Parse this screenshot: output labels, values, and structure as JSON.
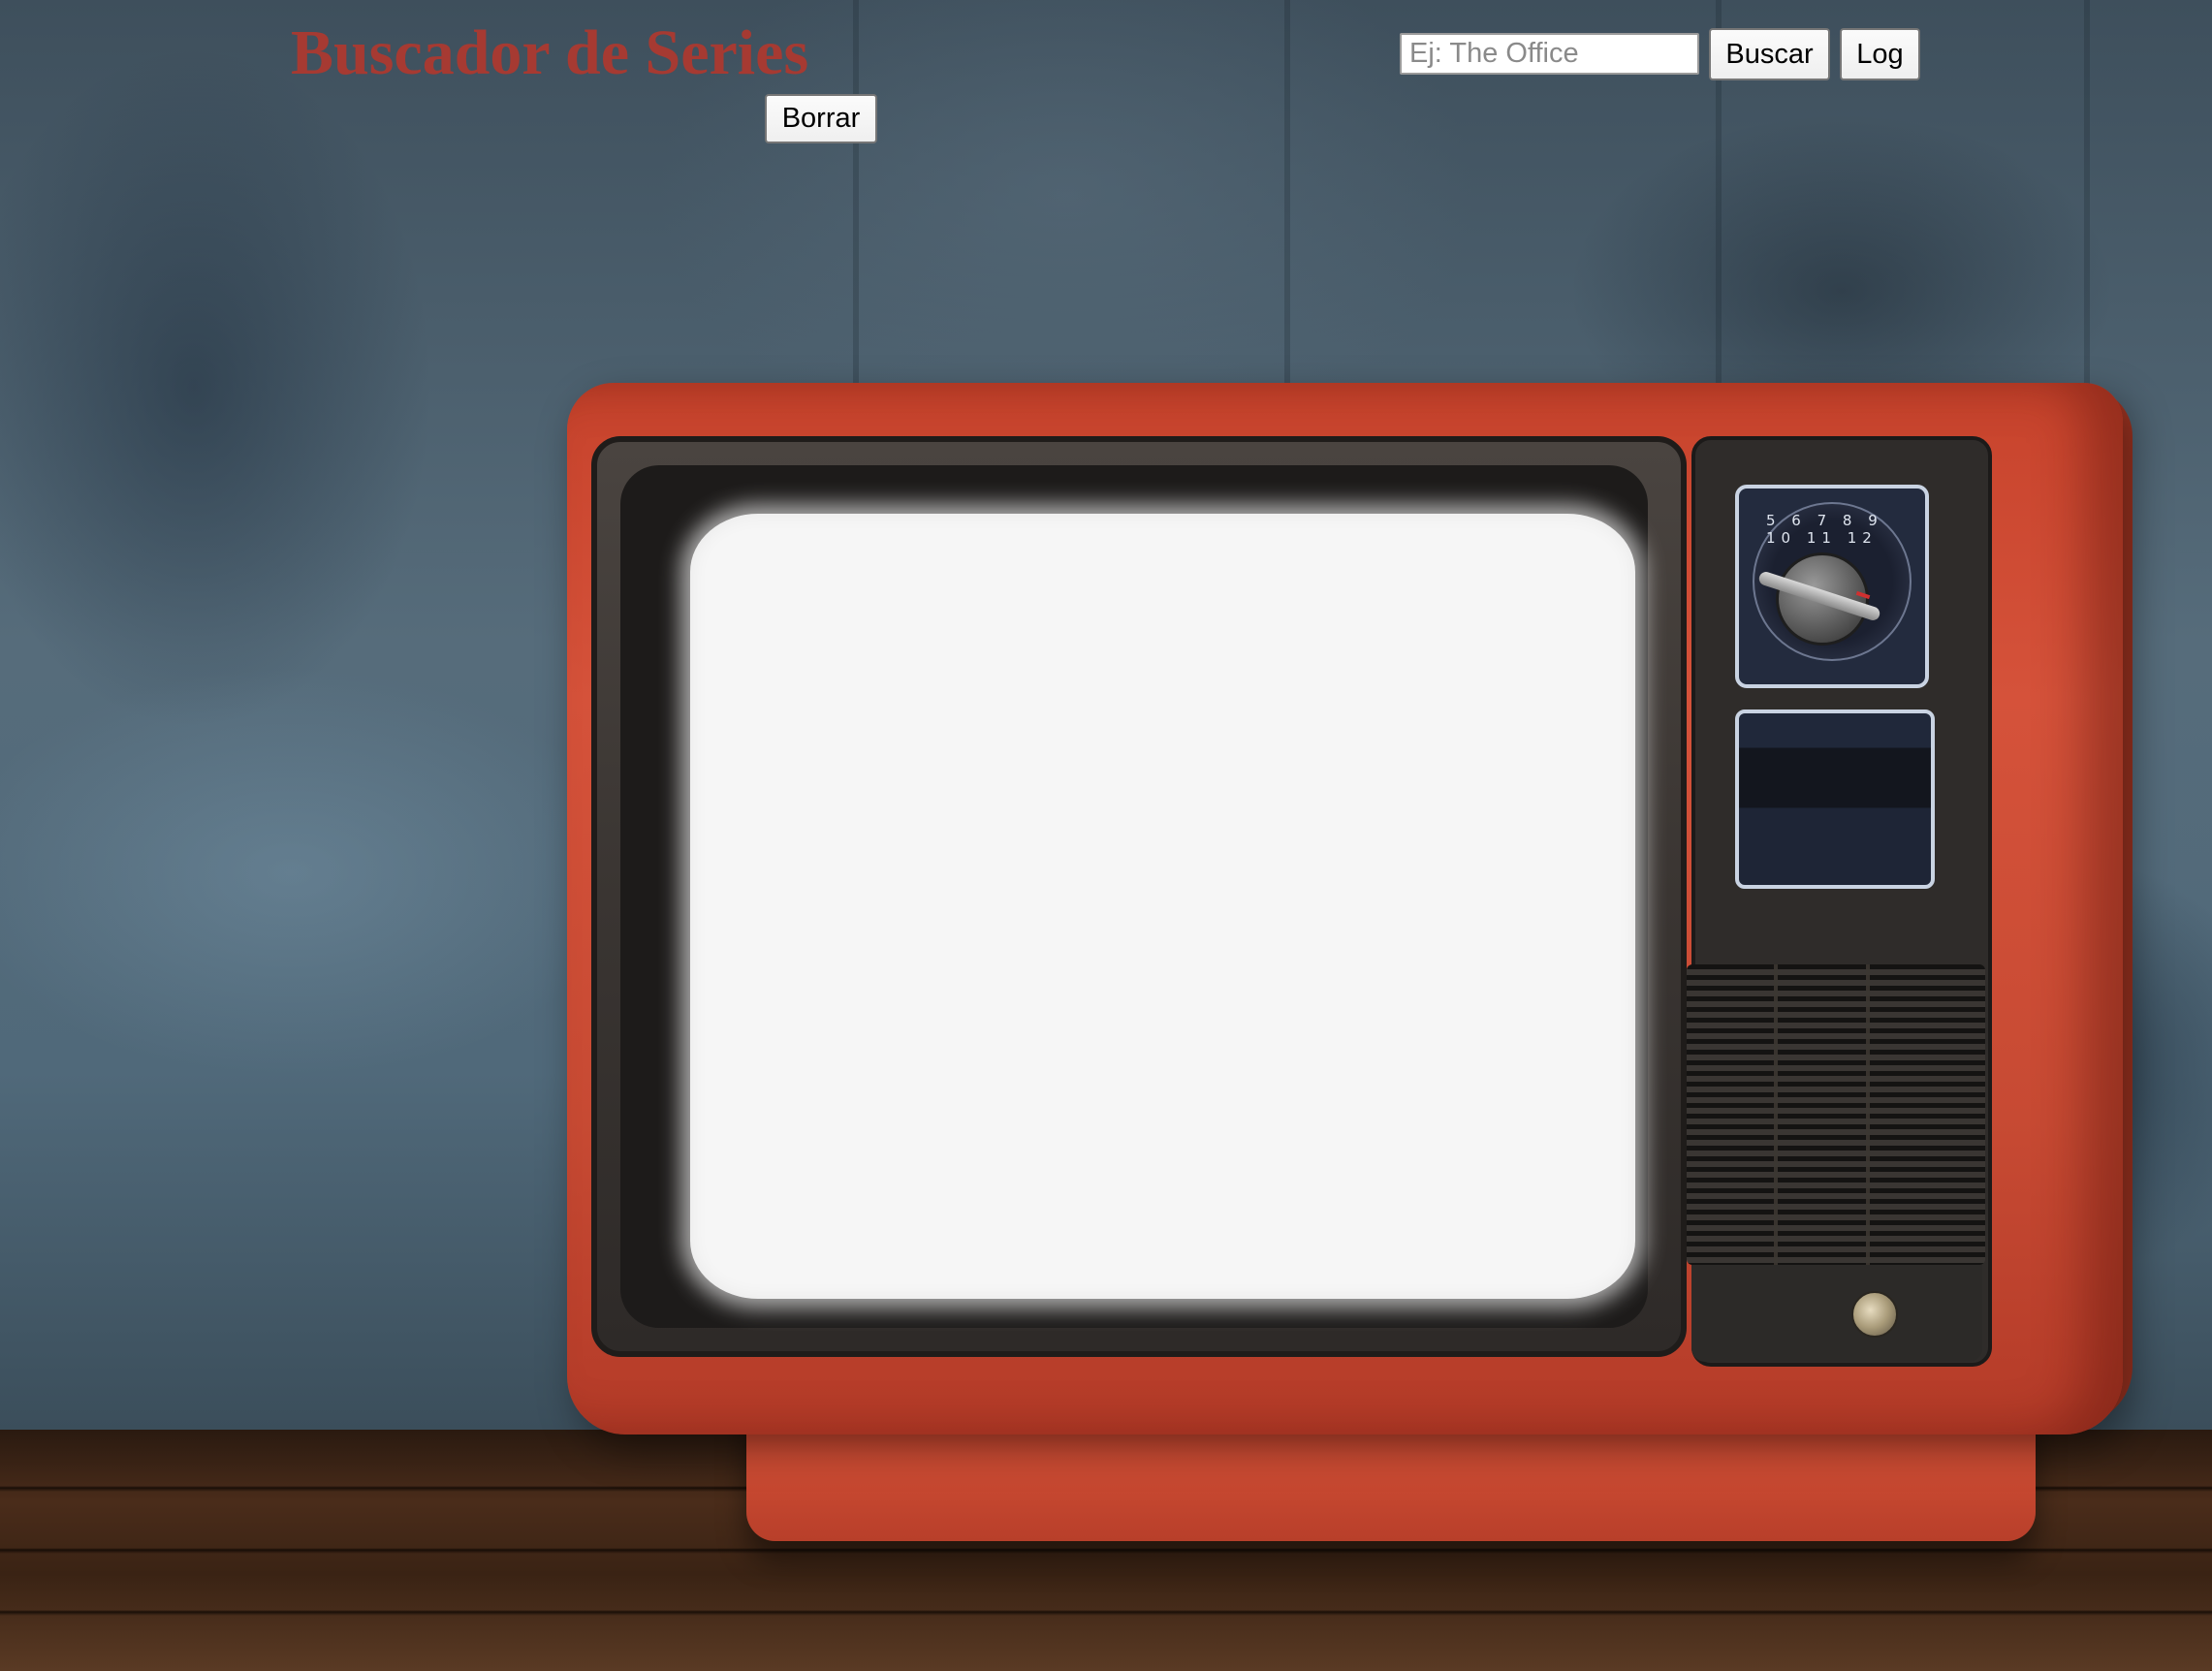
{
  "header": {
    "title": "Buscador de Series"
  },
  "search": {
    "placeholder": "Ej: The Office",
    "value": ""
  },
  "buttons": {
    "search_label": "Buscar",
    "log_label": "Log",
    "clear_label": "Borrar"
  },
  "background": {
    "description_icon": "retro-tv-photo-icon",
    "dial_numbers": "5 6 7 8 9 10 11 12"
  },
  "colors": {
    "title": "#a63a32",
    "tv_body": "#cf4d34",
    "screen": "#f6f6f6"
  }
}
